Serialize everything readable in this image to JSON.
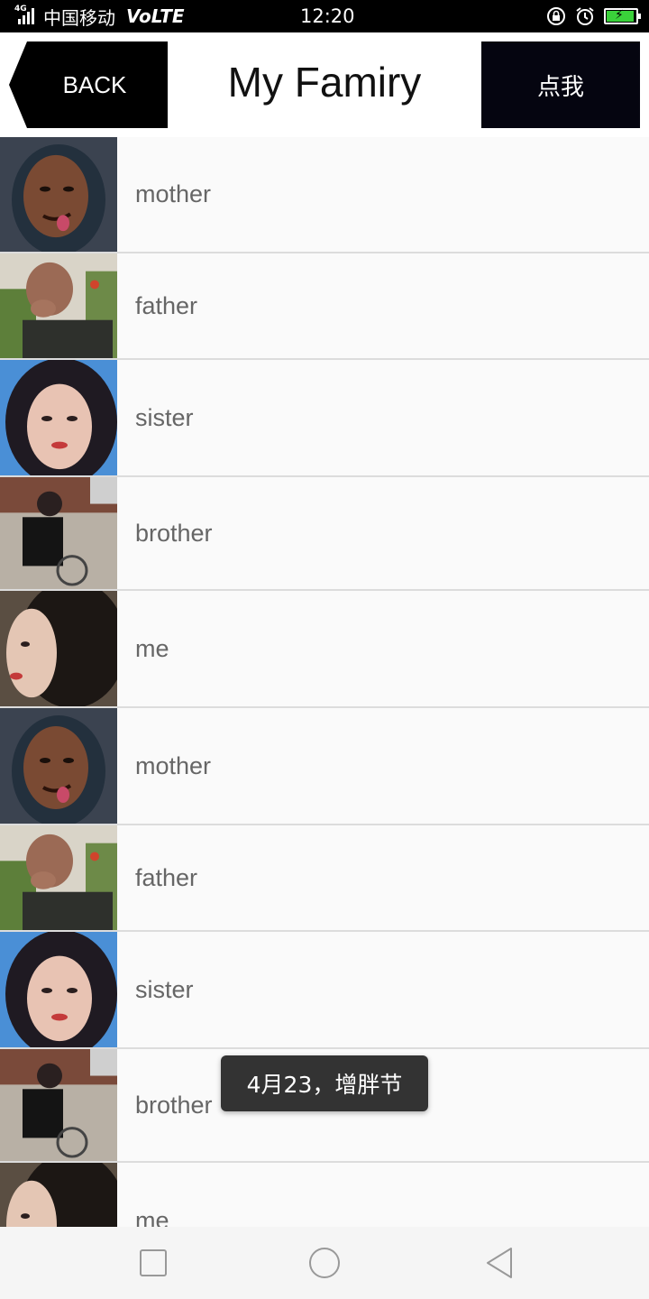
{
  "status_bar": {
    "network_tag": "4G",
    "carrier": "中国移动",
    "volte": "VoLTE",
    "time": "12:20",
    "battery_color": "#3ad13a",
    "icons": [
      "signal-icon",
      "lock-rotation-icon",
      "alarm-icon",
      "battery-charging-icon"
    ]
  },
  "header": {
    "back_label": "BACK",
    "title": "My Famiry",
    "action_label": "点我"
  },
  "list": {
    "items": [
      {
        "label": "mother",
        "avatar": "mother-avatar"
      },
      {
        "label": "father",
        "avatar": "father-avatar"
      },
      {
        "label": "sister",
        "avatar": "sister-avatar"
      },
      {
        "label": "brother",
        "avatar": "brother-avatar"
      },
      {
        "label": "me",
        "avatar": "me-avatar"
      },
      {
        "label": "mother",
        "avatar": "mother-avatar"
      },
      {
        "label": "father",
        "avatar": "father-avatar"
      },
      {
        "label": "sister",
        "avatar": "sister-avatar"
      },
      {
        "label": "brother",
        "avatar": "brother-avatar"
      },
      {
        "label": "me",
        "avatar": "me-avatar"
      }
    ]
  },
  "toast": {
    "text": "4月23，增胖节"
  },
  "nav_bar": {
    "buttons": [
      "recent-apps-icon",
      "home-icon",
      "back-triangle-icon"
    ]
  }
}
